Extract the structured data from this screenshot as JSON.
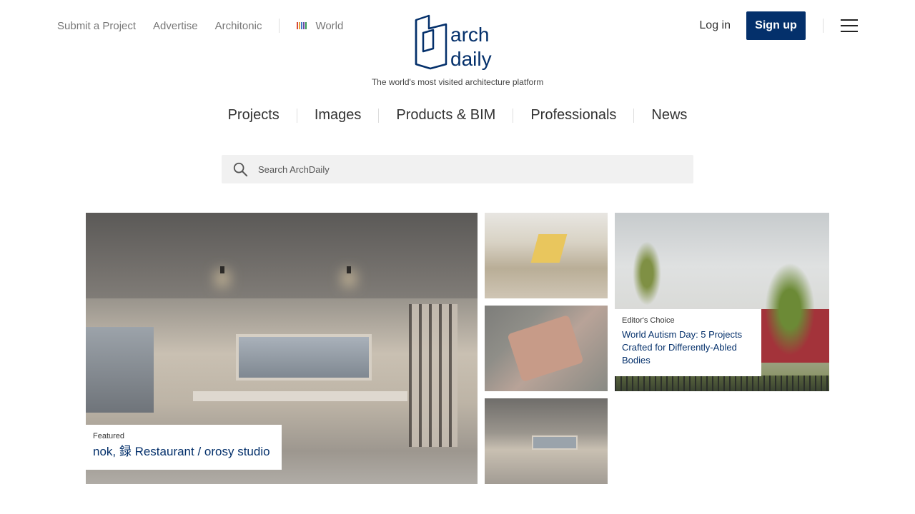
{
  "top_nav": {
    "links": [
      "Submit a Project",
      "Advertise",
      "Architonic"
    ],
    "world_label": "World"
  },
  "brand": {
    "logo_line1": "arch",
    "logo_line2": "daily",
    "tagline": "The world's most visited architecture platform",
    "color": "#04306b"
  },
  "account": {
    "login_label": "Log in",
    "signup_label": "Sign up"
  },
  "main_nav": [
    "Projects",
    "Images",
    "Products & BIM",
    "Professionals",
    "News"
  ],
  "search": {
    "placeholder": "Search ArchDaily"
  },
  "gallery": {
    "featured": {
      "kicker": "Featured",
      "title": "nok, 録 Restaurant / orosy studio"
    },
    "editor": {
      "kicker": "Editor's Choice",
      "title": "World Autism Day: 5 Projects Crafted for Differently-Abled Bodies"
    }
  },
  "icons": {
    "search": "search-icon",
    "menu": "hamburger-menu-icon",
    "world": "world-flag-icon"
  }
}
